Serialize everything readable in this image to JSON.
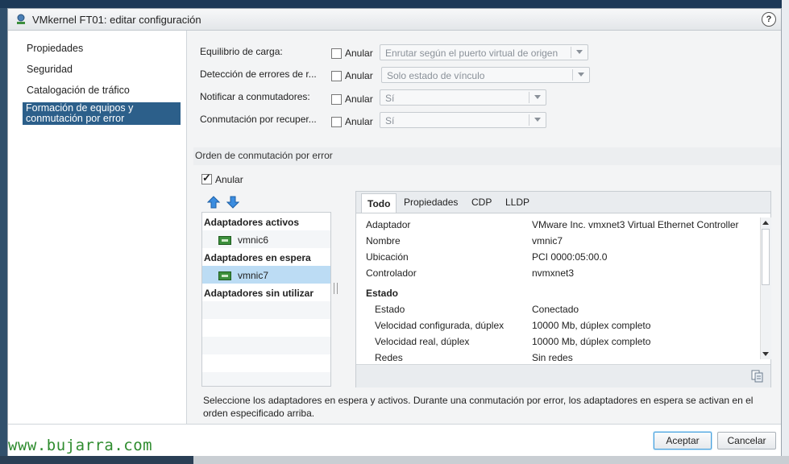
{
  "dialog": {
    "title": "VMkernel FT01: editar configuración",
    "help": "?"
  },
  "nav": {
    "items": [
      "Propiedades",
      "Seguridad",
      "Catalogación de tráfico"
    ],
    "selected_line1": "Formación de equipos y",
    "selected_line2": "conmutación por error"
  },
  "settings": {
    "rows": [
      {
        "label": "Equilibrio de carga:",
        "override": "Anular",
        "value": "Enrutar según el puerto virtual de origen"
      },
      {
        "label": "Detección de errores de r...",
        "override": "Anular",
        "value": "Solo estado de vínculo"
      },
      {
        "label": "Notificar a conmutadores:",
        "override": "Anular",
        "value": "Sí"
      },
      {
        "label": "Conmutación por recuper...",
        "override": "Anular",
        "value": "Sí"
      }
    ]
  },
  "failover": {
    "section_title": "Orden de conmutación por error",
    "override_label": "Anular",
    "override_checked": true,
    "groups": {
      "active": "Adaptadores activos",
      "active_item": "vmnic6",
      "standby": "Adaptadores en espera",
      "standby_item": "vmnic7",
      "unused": "Adaptadores sin utilizar"
    }
  },
  "details": {
    "tabs": [
      "Todo",
      "Propiedades",
      "CDP",
      "LLDP"
    ],
    "rows": [
      {
        "key": "Adaptador",
        "value": "VMware Inc. vmxnet3 Virtual Ethernet Controller"
      },
      {
        "key": "Nombre",
        "value": "vmnic7"
      },
      {
        "key": "Ubicación",
        "value": "PCI 0000:05:00.0"
      },
      {
        "key": "Controlador",
        "value": "nvmxnet3"
      }
    ],
    "estado_header": "Estado",
    "estado_rows": [
      {
        "key": "Estado",
        "value": "Conectado"
      },
      {
        "key": "Velocidad configurada, dúplex",
        "value": "10000 Mb, dúplex completo"
      },
      {
        "key": "Velocidad real, dúplex",
        "value": "10000 Mb, dúplex completo"
      },
      {
        "key": "Redes",
        "value": "Sin redes"
      }
    ]
  },
  "description": "Seleccione los adaptadores en espera y activos. Durante una conmutación por error, los adaptadores en espera se activan en el orden especificado arriba.",
  "buttons": {
    "ok": "Aceptar",
    "cancel": "Cancelar"
  },
  "watermark": "www.bujarra.com"
}
